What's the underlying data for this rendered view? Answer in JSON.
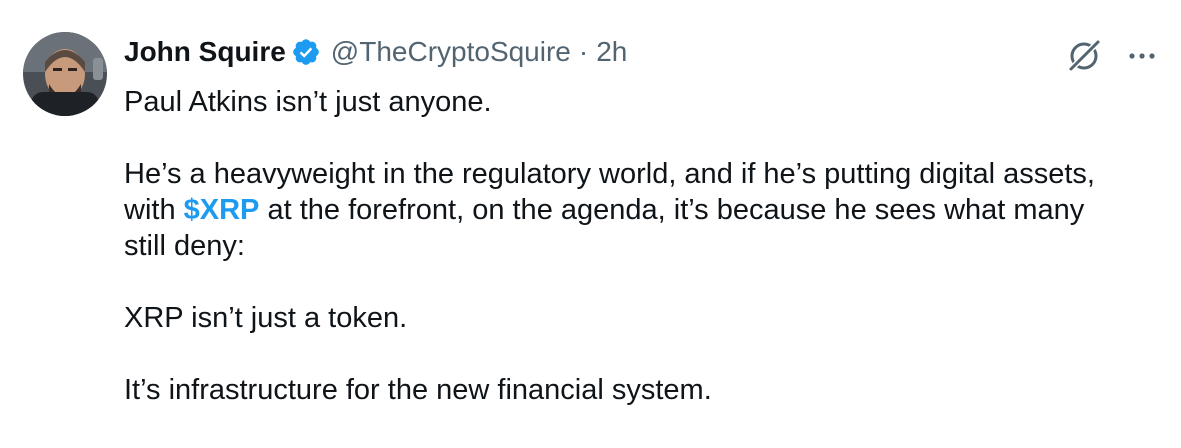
{
  "author": {
    "name": "John Squire",
    "handle": "@TheCryptoSquire",
    "separator": "·",
    "time": "2h"
  },
  "icons": {
    "verified": "verified-badge-icon",
    "grok": "grok-icon",
    "more": "more-horizontal-icon"
  },
  "colors": {
    "text": "#0f1419",
    "muted": "#536471",
    "accent": "#1d9bf0"
  },
  "tweet": {
    "line1": "Paul Atkins isn’t just anyone.",
    "para2_part1": "He’s a heavyweight in the regulatory world, and if he’s putting digital assets,",
    "para2_part2": "with ",
    "cashtag": "$XRP",
    "para2_part3": " at the forefront, on the agenda, it’s because he sees what many",
    "para2_part4": "still deny:",
    "line3": "XRP isn’t just a token.",
    "line4": "It’s infrastructure for the new financial system."
  }
}
